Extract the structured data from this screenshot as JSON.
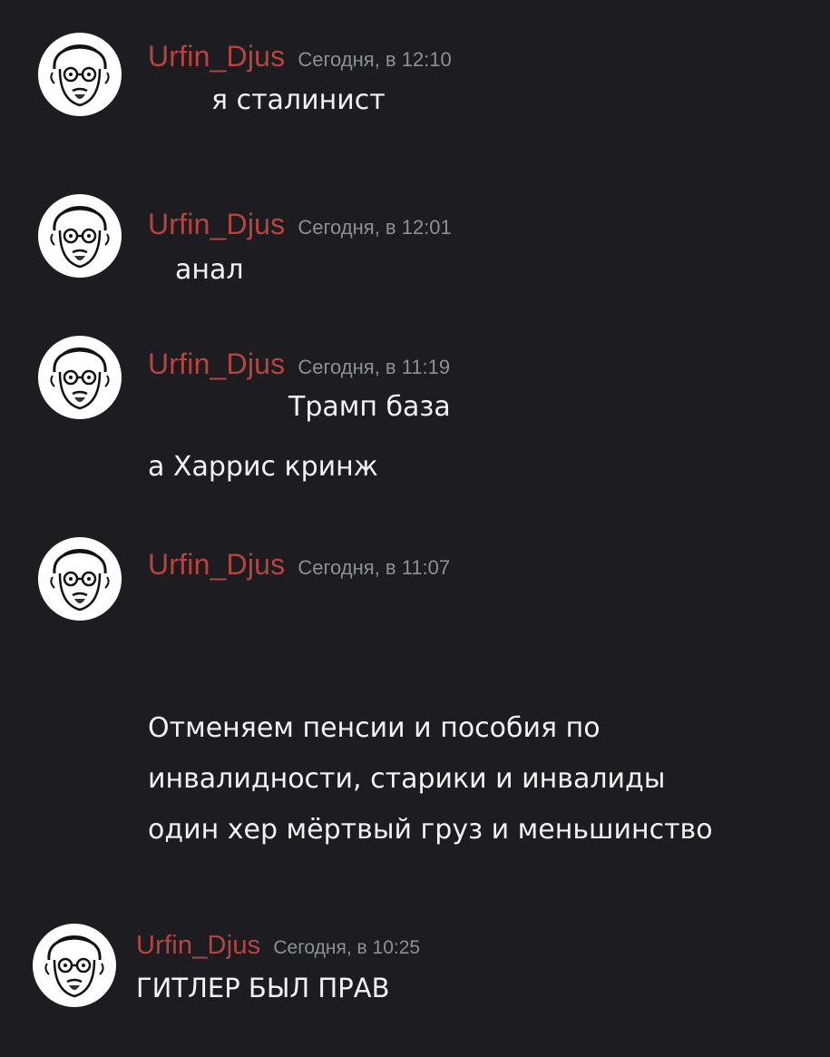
{
  "messages": [
    {
      "username": "Urfin_Djus",
      "timestamp": "Сегодня, в 12:10",
      "lines": [
        "я сталинист"
      ]
    },
    {
      "username": "Urfin_Djus",
      "timestamp": "Сегодня, в 12:01",
      "lines": [
        "анал"
      ]
    },
    {
      "username": "Urfin_Djus",
      "timestamp": "Сегодня, в 11:19",
      "lines": [
        "Трамп база",
        "а Харрис кринж"
      ]
    },
    {
      "username": "Urfin_Djus",
      "timestamp": "Сегодня, в 11:07",
      "lines": [
        "Отменяем пенсии и пособия по",
        "инвалидности, старики и инвалиды",
        "один хер мёртвый груз и меньшинство"
      ]
    },
    {
      "username": "Urfin_Djus",
      "timestamp": "Сегодня, в 10:25",
      "lines": [
        "ГИТЛЕР БЫЛ ПРАВ"
      ]
    }
  ],
  "avatar_icon": "cartoon-old-man-with-glasses-icon",
  "colors": {
    "background": "#1c1c21",
    "username": "#b5463f",
    "timestamp": "#8e9097",
    "text": "#f2f3f5"
  }
}
